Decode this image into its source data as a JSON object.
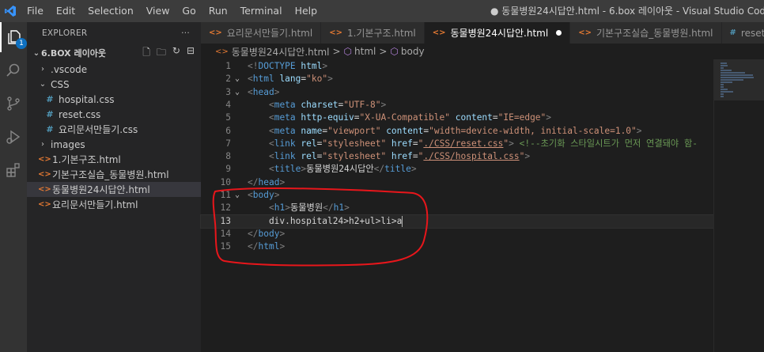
{
  "titlebar": {
    "menu": [
      "File",
      "Edit",
      "Selection",
      "View",
      "Go",
      "Run",
      "Terminal",
      "Help"
    ],
    "window_title": "● 동물병원24시답안.html - 6.box 레이아웃 - Visual Studio Code"
  },
  "activity": {
    "badge": "1",
    "icons": [
      "explorer-icon",
      "search-icon",
      "source-control-icon",
      "run-debug-icon",
      "extensions-icon"
    ]
  },
  "explorer": {
    "header": "EXPLORER",
    "more": "···",
    "folder": "6.BOX 레이아웃",
    "tree": [
      {
        "label": ".vscode",
        "kind": "folder",
        "open": false,
        "depth": 1
      },
      {
        "label": "CSS",
        "kind": "folder",
        "open": true,
        "depth": 1
      },
      {
        "label": "hospital.css",
        "kind": "css",
        "depth": 2
      },
      {
        "label": "reset.css",
        "kind": "css",
        "depth": 2
      },
      {
        "label": "요리문서만들기.css",
        "kind": "css",
        "depth": 2
      },
      {
        "label": "images",
        "kind": "folder",
        "open": false,
        "depth": 1
      },
      {
        "label": "1.기본구조.html",
        "kind": "html",
        "depth": 1
      },
      {
        "label": "기본구조실습_동물병원.html",
        "kind": "html",
        "depth": 1
      },
      {
        "label": "동물병원24시답안.html",
        "kind": "html",
        "depth": 1,
        "selected": true
      },
      {
        "label": "요리문서만들기.html",
        "kind": "html",
        "depth": 1
      }
    ]
  },
  "tabs": [
    {
      "label": "요리문서만들기.html",
      "kind": "html"
    },
    {
      "label": "1.기본구조.html",
      "kind": "html"
    },
    {
      "label": "동물병원24시답안.html",
      "kind": "html",
      "active": true,
      "modified": true
    },
    {
      "label": "기본구조실습_동물병원.html",
      "kind": "html"
    },
    {
      "label": "reset",
      "kind": "css"
    }
  ],
  "breadcrumb": {
    "file": "동물병원24시답안.html",
    "sep1": ">",
    "item1": "html",
    "sep2": ">",
    "item2": "body"
  },
  "code_lines": [
    [
      [
        "br",
        "<!"
      ],
      [
        "tag",
        "DOCTYPE"
      ],
      [
        "attr",
        " html"
      ],
      [
        "br",
        ">"
      ]
    ],
    [
      [
        "br",
        "<"
      ],
      [
        "tag",
        "html"
      ],
      [
        "attr",
        " lang"
      ],
      [
        "txt",
        "="
      ],
      [
        "str",
        "\"ko\""
      ],
      [
        "br",
        ">"
      ]
    ],
    [
      [
        "br",
        "<"
      ],
      [
        "tag",
        "head"
      ],
      [
        "br",
        ">"
      ]
    ],
    [
      [
        "txt",
        "    "
      ],
      [
        "br",
        "<"
      ],
      [
        "tag",
        "meta"
      ],
      [
        "attr",
        " charset"
      ],
      [
        "txt",
        "="
      ],
      [
        "str",
        "\"UTF-8\""
      ],
      [
        "br",
        ">"
      ]
    ],
    [
      [
        "txt",
        "    "
      ],
      [
        "br",
        "<"
      ],
      [
        "tag",
        "meta"
      ],
      [
        "attr",
        " http-equiv"
      ],
      [
        "txt",
        "="
      ],
      [
        "str",
        "\"X-UA-Compatible\""
      ],
      [
        "attr",
        " content"
      ],
      [
        "txt",
        "="
      ],
      [
        "str",
        "\"IE=edge\""
      ],
      [
        "br",
        ">"
      ]
    ],
    [
      [
        "txt",
        "    "
      ],
      [
        "br",
        "<"
      ],
      [
        "tag",
        "meta"
      ],
      [
        "attr",
        " name"
      ],
      [
        "txt",
        "="
      ],
      [
        "str",
        "\"viewport\""
      ],
      [
        "attr",
        " content"
      ],
      [
        "txt",
        "="
      ],
      [
        "str",
        "\"width=device-width, initial-scale=1.0\""
      ],
      [
        "br",
        ">"
      ]
    ],
    [
      [
        "txt",
        "    "
      ],
      [
        "br",
        "<"
      ],
      [
        "tag",
        "link"
      ],
      [
        "attr",
        " rel"
      ],
      [
        "txt",
        "="
      ],
      [
        "str",
        "\"stylesheet\""
      ],
      [
        "attr",
        " href"
      ],
      [
        "txt",
        "="
      ],
      [
        "str",
        "\""
      ],
      [
        "strlink",
        "./CSS/reset.css"
      ],
      [
        "str",
        "\""
      ],
      [
        "br",
        ">"
      ],
      [
        "txt",
        " "
      ],
      [
        "cmt",
        "<!--초기화 스타일시트가 먼저 연결돼야 함-"
      ]
    ],
    [
      [
        "txt",
        "    "
      ],
      [
        "br",
        "<"
      ],
      [
        "tag",
        "link"
      ],
      [
        "attr",
        " rel"
      ],
      [
        "txt",
        "="
      ],
      [
        "str",
        "\"stylesheet\""
      ],
      [
        "attr",
        " href"
      ],
      [
        "txt",
        "="
      ],
      [
        "str",
        "\""
      ],
      [
        "strlink",
        "./CSS/hospital.css"
      ],
      [
        "str",
        "\""
      ],
      [
        "br",
        ">"
      ]
    ],
    [
      [
        "txt",
        "    "
      ],
      [
        "br",
        "<"
      ],
      [
        "tag",
        "title"
      ],
      [
        "br",
        ">"
      ],
      [
        "txt",
        "동물병원24시답안"
      ],
      [
        "br",
        "</"
      ],
      [
        "tag",
        "title"
      ],
      [
        "br",
        ">"
      ]
    ],
    [
      [
        "br",
        "</"
      ],
      [
        "tag",
        "head"
      ],
      [
        "br",
        ">"
      ]
    ],
    [
      [
        "br",
        "<"
      ],
      [
        "tag",
        "body"
      ],
      [
        "br",
        ">"
      ]
    ],
    [
      [
        "txt",
        "    "
      ],
      [
        "br",
        "<"
      ],
      [
        "tag",
        "h1"
      ],
      [
        "br",
        ">"
      ],
      [
        "txt",
        "동물병원"
      ],
      [
        "br",
        "</"
      ],
      [
        "tag",
        "h1"
      ],
      [
        "br",
        ">"
      ]
    ],
    [
      [
        "txt",
        "    div.hospital24>h2+ul>li>a"
      ],
      [
        "cursor",
        ""
      ]
    ],
    [
      [
        "br",
        "</"
      ],
      [
        "tag",
        "body"
      ],
      [
        "br",
        ">"
      ]
    ],
    [
      [
        "br",
        "</"
      ],
      [
        "tag",
        "html"
      ],
      [
        "br",
        ">"
      ]
    ]
  ],
  "editor": {
    "current_line": 13,
    "fold_lines": [
      2,
      3,
      11
    ]
  },
  "colors": {
    "accent": "#007acc",
    "annotation": "#e8161b"
  }
}
